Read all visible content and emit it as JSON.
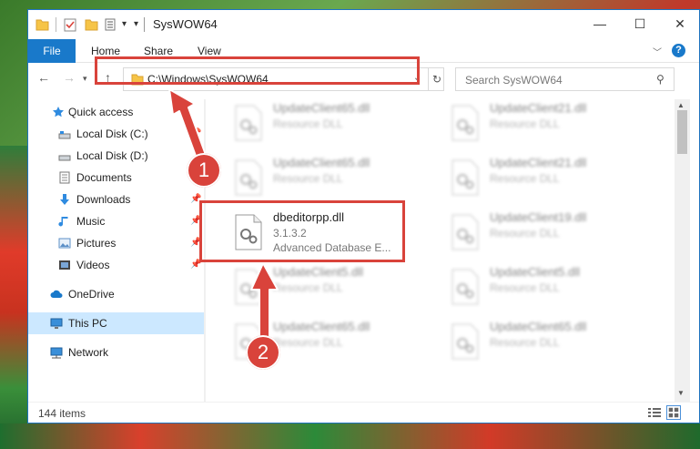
{
  "window": {
    "title": "SysWOW64",
    "controls": {
      "minimize": "—",
      "maximize": "☐",
      "close": "✕"
    }
  },
  "ribbon": {
    "tabs": [
      "File",
      "Home",
      "Share",
      "View"
    ],
    "help": "?"
  },
  "nav": {
    "address": "C:\\Windows\\SysWOW64",
    "search_placeholder": "Search SysWOW64"
  },
  "sidebar": {
    "items": [
      {
        "label": "Quick access",
        "icon": "star-icon"
      },
      {
        "label": "Local Disk (C:)",
        "icon": "drive-icon",
        "pinned": true
      },
      {
        "label": "Local Disk (D:)",
        "icon": "drive-icon"
      },
      {
        "label": "Documents",
        "icon": "documents-icon",
        "pinned": true
      },
      {
        "label": "Downloads",
        "icon": "download-icon",
        "pinned": true
      },
      {
        "label": "Music",
        "icon": "music-icon",
        "pinned": true
      },
      {
        "label": "Pictures",
        "icon": "pictures-icon",
        "pinned": true
      },
      {
        "label": "Videos",
        "icon": "videos-icon",
        "pinned": true
      },
      {
        "label": "OneDrive",
        "icon": "cloud-icon"
      },
      {
        "label": "This PC",
        "icon": "computer-icon",
        "selected": true
      },
      {
        "label": "Network",
        "icon": "network-icon"
      }
    ]
  },
  "files": [
    {
      "name": "UpdateClient65.dll",
      "line1": "Resource DLL",
      "line2": ""
    },
    {
      "name": "UpdateClient21.dll",
      "line1": "Resource DLL",
      "line2": ""
    },
    {
      "name": "UpdateClient65.dll",
      "line1": "Resource DLL",
      "line2": ""
    },
    {
      "name": "UpdateClient21.dll",
      "line1": "Resource DLL",
      "line2": ""
    },
    {
      "name": "dbeditorpp.dll",
      "line1": "3.1.3.2",
      "line2": "Advanced Database E..."
    },
    {
      "name": "UpdateClient19.dll",
      "line1": "Resource DLL",
      "line2": ""
    },
    {
      "name": "UpdateClient5.dll",
      "line1": "Resource DLL",
      "line2": ""
    },
    {
      "name": "UpdateClient5.dll",
      "line1": "Resource DLL",
      "line2": ""
    },
    {
      "name": "UpdateClient65.dll",
      "line1": "Resource DLL",
      "line2": ""
    },
    {
      "name": "UpdateClient65.dll",
      "line1": "Resource DLL",
      "line2": ""
    }
  ],
  "status": {
    "item_count": "144 items"
  },
  "callouts": [
    "1",
    "2"
  ],
  "colors": {
    "accent": "#1979ca",
    "highlight": "#d9433b",
    "selected": "#cce8ff"
  }
}
